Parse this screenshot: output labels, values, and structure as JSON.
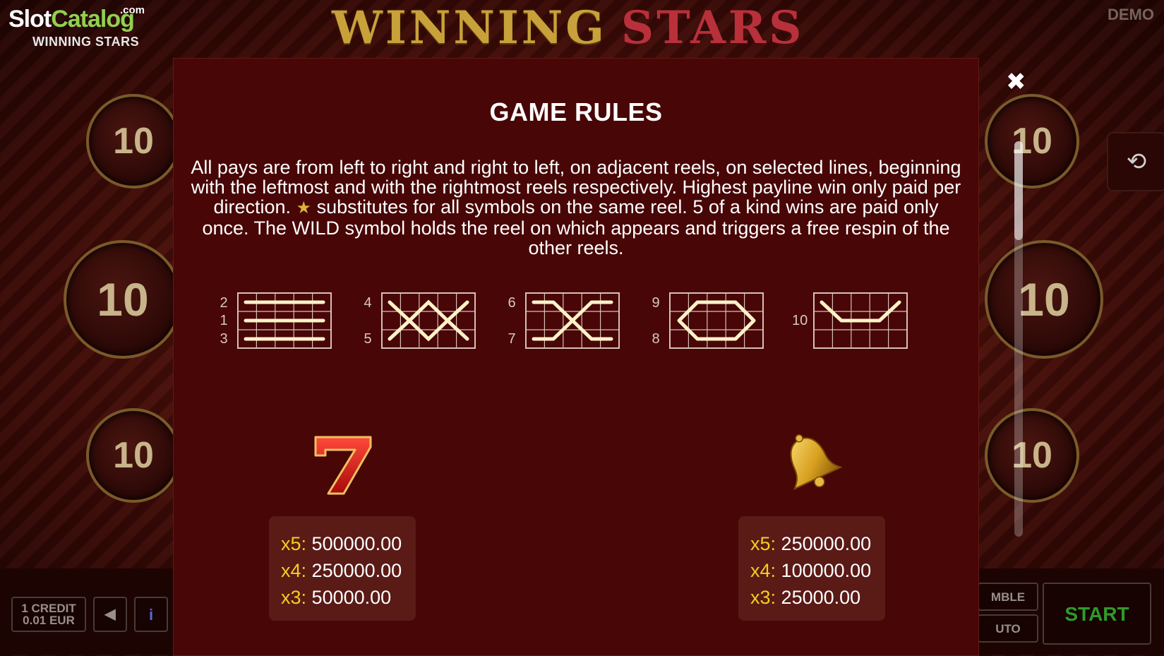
{
  "logo": {
    "brand_part1": "Slot",
    "brand_part2": "Catalog",
    "brand_suffix": ".com",
    "game_name": "WINNING STARS"
  },
  "title_banner": {
    "word1": "WINNING",
    "word2": "STARS"
  },
  "mode_badge": "DEMO",
  "bet_coins": {
    "value": "10"
  },
  "modal": {
    "title": "GAME RULES",
    "rules_part1": "All pays are from left to right and right to left, on adjacent reels, on selected lines, beginning with the leftmost and with the rightmost reels respectively. Highest payline win only paid per direction.",
    "rules_star_icon": "wild-star-icon",
    "rules_part2": "substitutes for all symbols on the same reel. 5 of a kind wins are paid only once. The WILD symbol holds the reel on which appears and triggers a free respin of the other reels.",
    "close_icon": "close-icon"
  },
  "paylines": [
    {
      "labels": [
        "2",
        "1",
        "3"
      ]
    },
    {
      "labels": [
        "4",
        "5"
      ]
    },
    {
      "labels": [
        "6",
        "7"
      ]
    },
    {
      "labels": [
        "9",
        "8"
      ]
    },
    {
      "labels": [
        "10"
      ]
    }
  ],
  "paytable": [
    {
      "symbol": "seven-icon",
      "rows": [
        {
          "k": "x5:",
          "v": "500000.00"
        },
        {
          "k": "x4:",
          "v": "250000.00"
        },
        {
          "k": "x3:",
          "v": "50000.00"
        }
      ]
    },
    {
      "symbol": "bell-icon",
      "rows": [
        {
          "k": "x5:",
          "v": "250000.00"
        },
        {
          "k": "x4:",
          "v": "100000.00"
        },
        {
          "k": "x3:",
          "v": "25000.00"
        }
      ]
    }
  ],
  "controls": {
    "credit_line1": "1 CREDIT",
    "credit_line2": "0.01 EUR",
    "sound_icon": "speaker-icon",
    "info_icon": "info-icon",
    "gamble_visible": "MBLE",
    "auto_visible": "UTO",
    "start": "START",
    "history_icon": "history-icon"
  },
  "colors": {
    "modal_bg": "#480606",
    "multiplier_accent": "#f0d020",
    "start_green": "#2f9a2a"
  }
}
